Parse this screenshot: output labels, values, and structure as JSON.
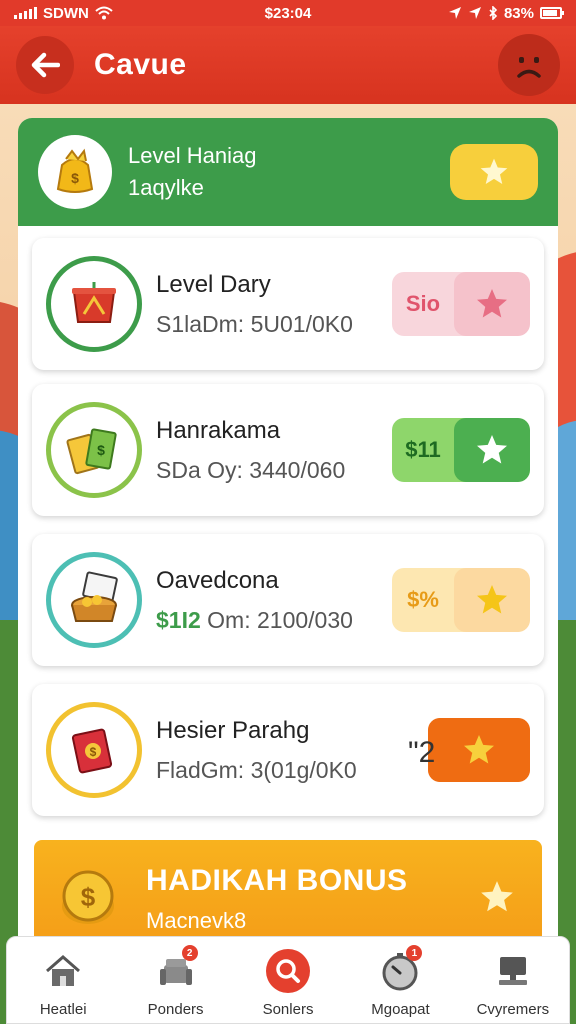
{
  "status_bar": {
    "carrier": "SDWN",
    "time": "$23:04",
    "battery": "83%"
  },
  "header": {
    "title": "Cavue"
  },
  "level_header": {
    "title": "Level Haniag",
    "subtitle": "1aqylke"
  },
  "cards": [
    {
      "title": "Level Dary",
      "subtitle": "S1laDm: 5U01/0K0",
      "price": "Sio",
      "accent_color": "#3d9c4a",
      "price_bg": "#f8d6dc",
      "price_color": "#e0546c",
      "star_bg": "#f5c2cb",
      "star_color": "#e76e84"
    },
    {
      "title": "Hanrakama",
      "subtitle": "SDa Oy: 3440/060",
      "price": "$11",
      "accent_color": "#8bc34a",
      "price_bg": "#8ed66b",
      "price_color": "#1e6b22",
      "star_bg": "#4caf50",
      "star_color": "#ffffff"
    },
    {
      "title": "Oavedcona",
      "subtitle_accent": "$1I2",
      "subtitle_rest": " Om: 2100/030",
      "price": "$%",
      "accent_color": "#4dbfb4",
      "price_bg": "#fde7b1",
      "price_color": "#e79b17",
      "star_bg": "#fcd9a0",
      "star_color": "#f5c518"
    },
    {
      "title": "Hesier Parahg",
      "subtitle": "FladGm: 3(01g/0K0",
      "price": "",
      "quote": "\"2",
      "accent_color": "#f2c230",
      "price_bg": "#f47a1f",
      "price_color": "#ffffff",
      "star_bg": "#ef6c12",
      "star_color": "#f7d03c"
    }
  ],
  "bonus": {
    "title": "HADIKAH BONUS",
    "subtitle": "Macnevk8"
  },
  "nav": [
    {
      "label": "Heatlei",
      "icon": "home-icon",
      "badge": ""
    },
    {
      "label": "Ponders",
      "icon": "chair-icon",
      "badge": "2"
    },
    {
      "label": "Sonlers",
      "icon": "search-icon",
      "badge": ""
    },
    {
      "label": "Mgoapat",
      "icon": "stopwatch-icon",
      "badge": "1"
    },
    {
      "label": "Cvyremers",
      "icon": "computer-icon",
      "badge": ""
    }
  ],
  "colors": {
    "header_red": "#e13a2a",
    "level_green": "#3d9c4a",
    "bonus_orange": "#f7a81b"
  }
}
